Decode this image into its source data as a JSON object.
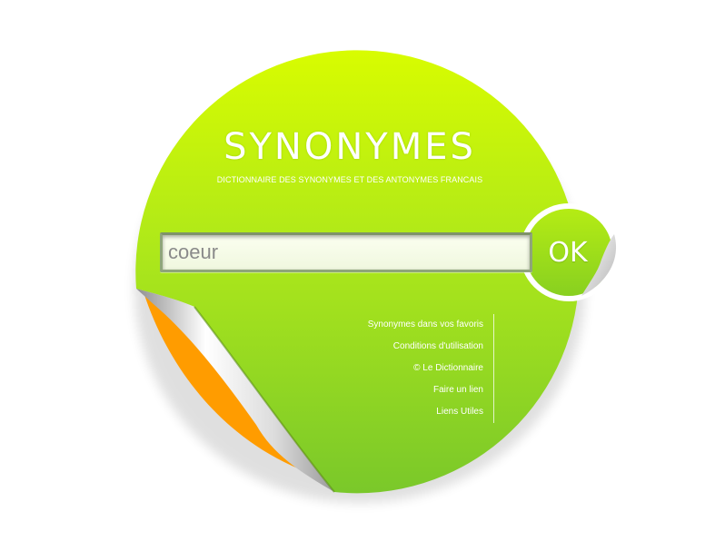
{
  "header": {
    "title": "SYNONYMES",
    "subtitle": "DICTIONNAIRE DES SYNONYMES ET DES ANTONYMES FRANCAIS"
  },
  "search": {
    "value": "coeur",
    "button_label": "OK"
  },
  "footer_links": [
    "Synonymes dans vos favoris",
    "Conditions d'utilisation",
    "© Le Dictionnaire",
    "Faire un lien",
    "Liens Utiles"
  ],
  "colors": {
    "sticker_light": "#d8fc00",
    "sticker_mid": "#a6e41a",
    "sticker_dark": "#78c828",
    "peel_orange": "#ff9c00",
    "text": "#ffffff"
  }
}
